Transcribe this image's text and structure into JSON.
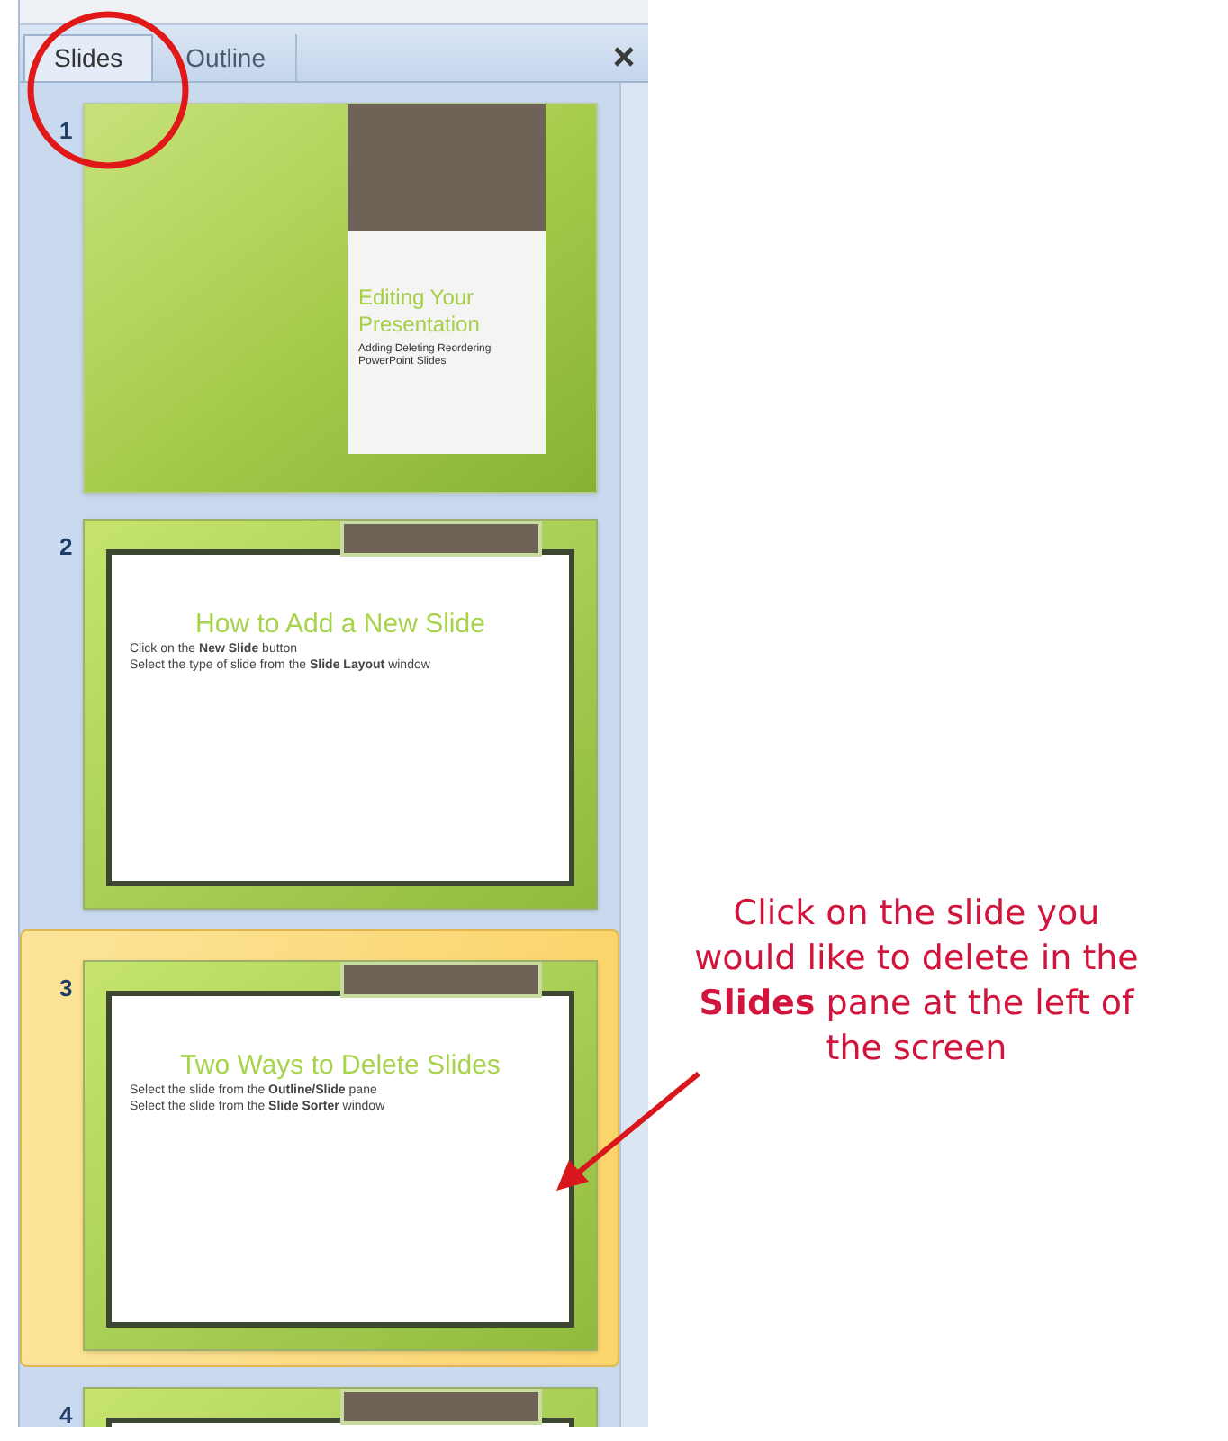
{
  "pane": {
    "tabs": [
      {
        "label": "Slides",
        "selected": true
      },
      {
        "label": "Outline",
        "selected": false
      }
    ],
    "slides": [
      {
        "number": "1",
        "kind": "title",
        "selected": false,
        "title": "Editing Your Presentation",
        "subtitle": "Adding Deleting Reordering PowerPoint Slides"
      },
      {
        "number": "2",
        "kind": "content",
        "selected": false,
        "title": "How to Add a New Slide",
        "bullets": [
          "Click on the **New Slide** button",
          "Select the type of slide from the **Slide Layout** window"
        ]
      },
      {
        "number": "3",
        "kind": "content",
        "selected": true,
        "title": "Two Ways to Delete Slides",
        "bullets": [
          "Select the slide from the **Outline/Slide** pane",
          "Select the slide from the **Slide Sorter** window"
        ]
      },
      {
        "number": "4",
        "kind": "content",
        "selected": false
      }
    ]
  },
  "annotation": {
    "text": "Click on the slide you would like to delete in the **Slides** pane at the left of the screen"
  }
}
